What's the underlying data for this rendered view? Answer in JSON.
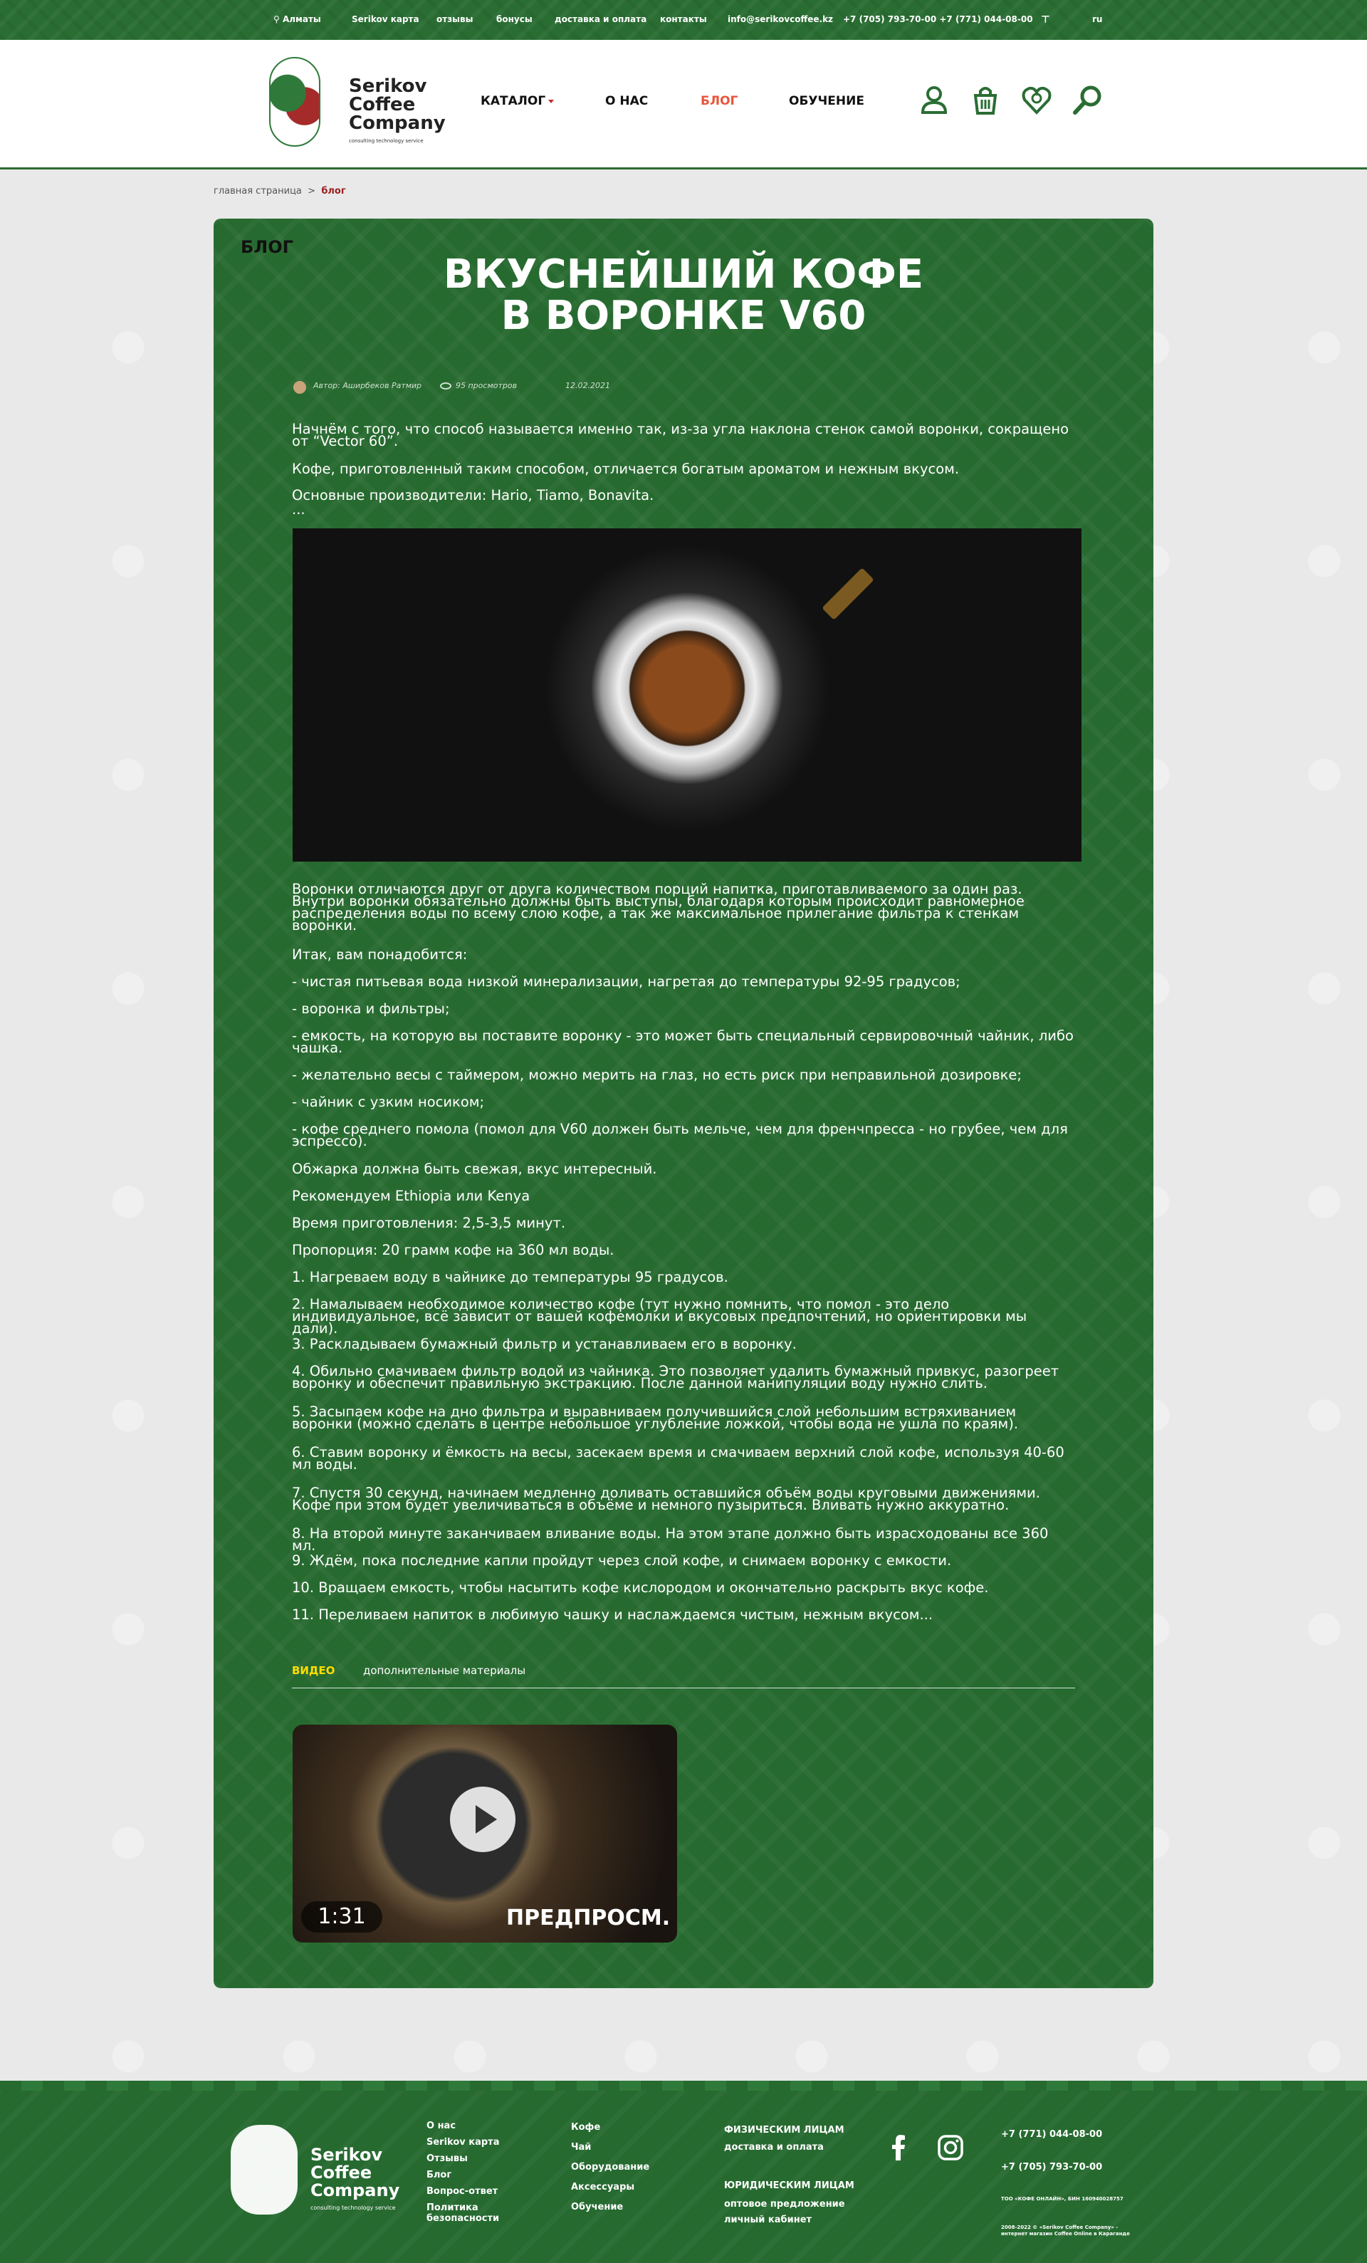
{
  "topbar": {
    "city": "Алматы",
    "links": [
      "Serikov карта",
      "отзывы",
      "бонусы",
      "доставка и оплата",
      "контакты"
    ],
    "email": "info@serikovcoffee.kz",
    "phones": "+7 (705) 793-70-00 +7 (771) 044-08-00",
    "lang": "ru"
  },
  "header": {
    "logo_line1": "Serikov",
    "logo_line2": "Coffee",
    "logo_line3": "Company",
    "logo_sub": "consulting technology service",
    "nav": [
      "КАТАЛОГ",
      "О НАС",
      "БЛОГ",
      "ОБУЧЕНИЕ"
    ],
    "icons": [
      "user-icon",
      "basket-icon",
      "favorites-icon",
      "search-icon"
    ]
  },
  "breadcrumb": {
    "home": "главная страница",
    "sep": ">",
    "current": "блог"
  },
  "article": {
    "tag": "БЛОГ",
    "title_line1": "ВКУСНЕЙШИЙ КОФЕ",
    "title_line2": "В ВОРОНКЕ V60",
    "author": "Автор: Аширбеков Ратмир",
    "views": "95 просмотров",
    "date": "12.02.2021",
    "paragraphs": [
      "Начнём с того, что способ называется именно так, из-за угла наклона стенок самой воронки, сокращено от “Vector 60”.",
      "Кофе, приготовленный таким способом, отличается богатым ароматом и нежным вкусом.",
      "Основные производители: Hario, Tiamo, Bonavita.",
      "...",
      "Воронки отличаются друг от друга количеством порций напитка, приготавливаемого за один раз. Внутри воронки обязательно должны быть выступы, благодаря которым происходит равномерное распределения воды по всему слою кофе, а так же максимальное прилегание фильтра к стенкам воронки.",
      "Итак, вам понадобится:",
      "- чистая питьевая вода низкой минерализации, нагретая до температуры 92-95 градусов;",
      "- воронка и фильтры;",
      "- емкость, на которую вы поставите воронку - это может быть специальный сервировочный чайник, либо чашка.",
      "- желательно весы с таймером, можно мерить на глаз, но есть риск при неправильной дозировке;",
      "- чайник с узким носиком;",
      "- кофе среднего помола (помол для V60 должен быть мельче, чем для френчпресса - но грубее, чем для эспрессо).",
      "Обжарка должна быть свежая, вкус интересный.",
      "Рекомендуем Ethiopia или Kenya",
      "Время приготовления: 2,5-3,5 минут.",
      "Пропорция: 20 грамм кофе на 360 мл воды.",
      "1. Нагреваем воду в чайнике до температуры 95 градусов.",
      "2. Намалываем необходимое количество кофе (тут нужно помнить, что помол - это дело индивидуальное, всё зависит от вашей кофемолки и вкусовых предпочтений, но ориентировки мы дали).",
      "3. Раскладываем бумажный фильтр и устанавливаем его в воронку.",
      "4. Обильно смачиваем фильтр водой из чайника. Это позволяет удалить бумажный привкус, разогреет воронку и обеспечит правильную экстракцию. После данной манипуляции воду нужно слить.",
      "5. Засыпаем кофе на дно фильтра и выравниваем получившийся слой небольшим встряхиванием воронки (можно сделать в центре небольшое углубление ложкой, чтобы вода не ушла по краям).",
      "6. Ставим воронку и ёмкость на весы, засекаем время и смачиваем верхний слой кофе, используя 40-60 мл воды.",
      "7. Спустя 30 секунд, начинаем медленно доливать оставшийся объём воды круговыми движениями. Кофе при этом будет увеличиваться в объёме и немного пузыриться. Вливать нужно аккуратно.",
      "8. На второй минуте заканчиваем вливание воды. На этом этапе должно быть израсходованы все 360 мл.",
      "9. Ждём, пока последние капли пройдут через слой кофе, и снимаем воронку с емкости.",
      "10. Вращаем емкость, чтобы насытить кофе кислородом и окончательно раскрыть вкус кофе.",
      "11. Переливаем напиток в любимую чашку и наслаждаемся чистым, нежным вкусом..."
    ],
    "tabs": [
      "ВИДЕО",
      "дополнительные материалы"
    ],
    "video_duration": "1:31",
    "video_label": "ПРЕДПРОСМ."
  },
  "footer": {
    "logo_line1": "Serikov",
    "logo_line2": "Coffee",
    "logo_line3": "Company",
    "logo_sub": "consulting technology service",
    "col1": [
      "О нас",
      "Serikov карта",
      "Отзывы",
      "Блог",
      "Вопрос-ответ",
      "Политика",
      "безопасности"
    ],
    "col2": [
      "Кофе",
      "Чай",
      "Оборудование",
      "Аксессуары",
      "Обучение"
    ],
    "col3_title1": "ФИЗИЧЕСКИМ ЛИЦАМ",
    "col3_link1": "доставка и оплата",
    "col3_title2": "ЮРИДИЧЕСКИМ ЛИЦАМ",
    "col3_link2": "оптовое предложение",
    "col3_link3": "личный кабинет",
    "phone1": "+7 (771) 044-08-00",
    "phone2": "+7 (705) 793-70-00",
    "legal1": "ТОО «КОФЕ ОНЛАЙН», БИН 160940028757",
    "legal2": "2008-2022 © «Serikov Coffee Company» -",
    "legal3": "интернет магазин Coffee Online в Караганде"
  },
  "colors": {
    "brand_green": "#276a30",
    "accent_red": "#c52b2b",
    "active_nav": "#e8553d",
    "tab_active": "#ffde00"
  }
}
